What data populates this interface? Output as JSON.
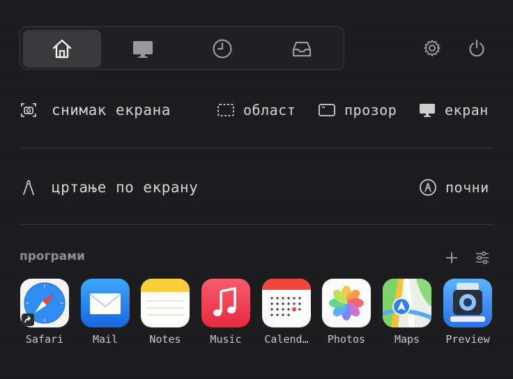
{
  "tabs": [
    {
      "icon": "home-icon",
      "active": true
    },
    {
      "icon": "display-icon",
      "active": false
    },
    {
      "icon": "clock-icon",
      "active": false
    },
    {
      "icon": "inbox-icon",
      "active": false
    }
  ],
  "screenshot": {
    "label": "снимак екрана",
    "area_label": "област",
    "window_label": "прозор",
    "screen_label": "екран"
  },
  "draw": {
    "label": "цртање по екрану",
    "start_label": "почни"
  },
  "apps": {
    "title": "програми",
    "items": [
      {
        "name": "Safari"
      },
      {
        "name": "Mail"
      },
      {
        "name": "Notes"
      },
      {
        "name": "Music"
      },
      {
        "name": "Calend…"
      },
      {
        "name": "Photos"
      },
      {
        "name": "Maps"
      },
      {
        "name": "Preview"
      }
    ]
  }
}
